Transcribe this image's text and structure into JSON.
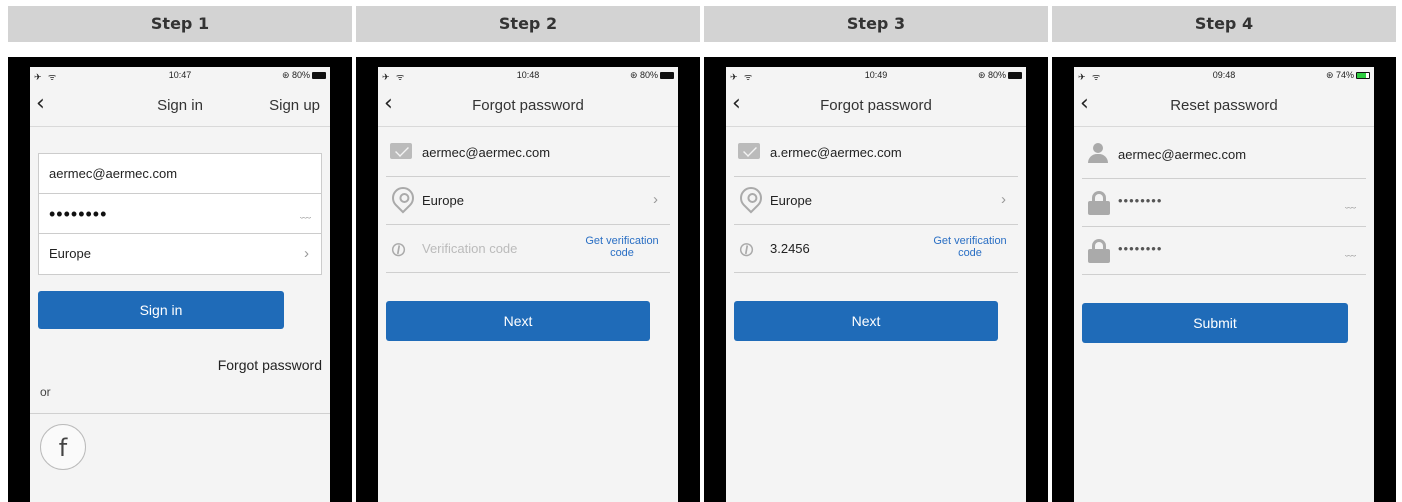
{
  "steps": [
    {
      "title": "Step 1",
      "status": {
        "left": "✈ ᯤ",
        "time": "10:47",
        "right": "⊛ 80%"
      },
      "nav": {
        "back": "‹",
        "title": "Sign in",
        "right": "Sign up"
      },
      "email": "aermec@aermec.com",
      "password": "••••••••",
      "eye": "﹏",
      "region": "Europe",
      "chevron": "›",
      "sign_in_button": "Sign in",
      "forgot": "Forgot password",
      "or": "or",
      "facebook": "f"
    },
    {
      "title": "Step 2",
      "status": {
        "left": "✈ ᯤ",
        "time": "10:48",
        "right": "⊛ 80%"
      },
      "nav": {
        "back": "‹",
        "title": "Forgot password"
      },
      "email": "aermec@aermec.com",
      "region": "Europe",
      "chevron": "›",
      "code_placeholder": "Verification code",
      "link_icon": "⊘",
      "get_code_line1": "Get verification",
      "get_code_line2": "code",
      "next_button": "Next"
    },
    {
      "title": "Step 3",
      "status": {
        "left": "✈ ᯤ",
        "time": "10:49",
        "right": "⊛ 80%"
      },
      "nav": {
        "back": "‹",
        "title": "Forgot password"
      },
      "email": "a.ermec@aermec.com",
      "region": "Europe",
      "chevron": "›",
      "code_value": "3.2456",
      "link_icon": "⊘",
      "get_code_line1": "Get verification",
      "get_code_line2": "code",
      "next_button": "Next"
    },
    {
      "title": "Step 4",
      "status": {
        "left": "✈ ᯤ",
        "time": "09:48",
        "right": "⊛ 74%"
      },
      "nav": {
        "back": "‹",
        "title": "Reset password"
      },
      "email": "aermec@aermec.com",
      "new_password": "••••••••",
      "confirm_password": "••••••••",
      "eye": "﹏",
      "submit_button": "Submit"
    }
  ],
  "colors": {
    "primary_button": "#1f6bb8",
    "link": "#2a6fc4",
    "header_bg": "#d3d3d3",
    "screen_bg": "#f4f4f4"
  }
}
